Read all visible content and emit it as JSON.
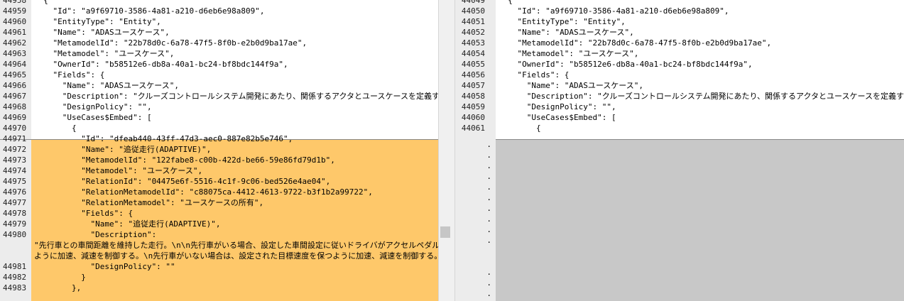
{
  "left": {
    "lines": [
      {
        "n": "44958",
        "t": "  {",
        "state": "same"
      },
      {
        "n": "44959",
        "t": "    \"Id\": \"a9f69710-3586-4a81-a210-d6eb6e98a809\",",
        "state": "same"
      },
      {
        "n": "44960",
        "t": "    \"EntityType\": \"Entity\",",
        "state": "same"
      },
      {
        "n": "44961",
        "t": "    \"Name\": \"ADASユースケース\",",
        "state": "same"
      },
      {
        "n": "44962",
        "t": "    \"MetamodelId\": \"22b78d0c-6a78-47f5-8f0b-e2b0d9ba17ae\",",
        "state": "same"
      },
      {
        "n": "44963",
        "t": "    \"Metamodel\": \"ユースケース\",",
        "state": "same"
      },
      {
        "n": "44964",
        "t": "    \"OwnerId\": \"b58512e6-db8a-40a1-bc24-bf8bdc144f9a\",",
        "state": "same"
      },
      {
        "n": "44965",
        "t": "    \"Fields\": {",
        "state": "same"
      },
      {
        "n": "44966",
        "t": "      \"Name\": \"ADASユースケース\",",
        "state": "same"
      },
      {
        "n": "44967",
        "t": "      \"Description\": \"クルーズコントロールシステム開発にあたり、関係するアクタとユースケースを定義する。\",",
        "state": "same"
      },
      {
        "n": "44968",
        "t": "      \"DesignPolicy\": \"\",",
        "state": "same"
      },
      {
        "n": "44969",
        "t": "      \"UseCases$Embed\": [",
        "state": "same"
      },
      {
        "n": "44970",
        "t": "        {",
        "state": "same"
      },
      {
        "n": "44971",
        "t": "          \"Id\": \"dfeab440-43ff-47d3-aec0-887e82b5e746\",",
        "state": "changed"
      },
      {
        "n": "44972",
        "t": "          \"Name\": \"追従走行(ADAPTIVE)\",",
        "state": "changed"
      },
      {
        "n": "44973",
        "t": "          \"MetamodelId\": \"122fabe8-c00b-422d-be66-59e86fd79d1b\",",
        "state": "changed"
      },
      {
        "n": "44974",
        "t": "          \"Metamodel\": \"ユースケース\",",
        "state": "changed"
      },
      {
        "n": "44975",
        "t": "          \"RelationId\": \"04475e6f-5516-4c1f-9c06-bed526e4ae04\",",
        "state": "changed"
      },
      {
        "n": "44976",
        "t": "          \"RelationMetamodelId\": \"c88075ca-4412-4613-9722-b3f1b2a99722\",",
        "state": "changed"
      },
      {
        "n": "44977",
        "t": "          \"RelationMetamodel\": \"ユースケースの所有\",",
        "state": "changed"
      },
      {
        "n": "44978",
        "t": "          \"Fields\": {",
        "state": "changed"
      },
      {
        "n": "44979",
        "t": "            \"Name\": \"追従走行(ADAPTIVE)\",",
        "state": "changed"
      },
      {
        "n": "44980",
        "t": "            \"Description\":",
        "state": "changed"
      },
      {
        "n": "",
        "t": "\"先行車との車間距離を維持した走行。\\n\\n先行車がいる場合、設定した車間設定に従いドライバがアクセルペダルを踏",
        "state": "wrap"
      },
      {
        "n": "",
        "t": "ように加速、減速を制御する。\\n先行車がいない場合は、設定された目標速度を保つように加速、減速を制御する。\",",
        "state": "wrap"
      },
      {
        "n": "44981",
        "t": "            \"DesignPolicy\": \"\"",
        "state": "changed"
      },
      {
        "n": "44982",
        "t": "          }",
        "state": "changed"
      },
      {
        "n": "44983",
        "t": "        },",
        "state": "changed"
      }
    ]
  },
  "right": {
    "lines": [
      {
        "n": "44049",
        "t": "  {"
      },
      {
        "n": "44050",
        "t": "    \"Id\": \"a9f69710-3586-4a81-a210-d6eb6e98a809\","
      },
      {
        "n": "44051",
        "t": "    \"EntityType\": \"Entity\","
      },
      {
        "n": "44052",
        "t": "    \"Name\": \"ADASユースケース\","
      },
      {
        "n": "44053",
        "t": "    \"MetamodelId\": \"22b78d0c-6a78-47f5-8f0b-e2b0d9ba17ae\","
      },
      {
        "n": "44054",
        "t": "    \"Metamodel\": \"ユースケース\","
      },
      {
        "n": "44055",
        "t": "    \"OwnerId\": \"b58512e6-db8a-40a1-bc24-bf8bdc144f9a\","
      },
      {
        "n": "44056",
        "t": "    \"Fields\": {"
      },
      {
        "n": "44057",
        "t": "      \"Name\": \"ADASユースケース\","
      },
      {
        "n": "44058",
        "t": "      \"Description\": \"クルーズコントロールシステム開発にあたり、関係するアクタとユースケースを定義する。\","
      },
      {
        "n": "44059",
        "t": "      \"DesignPolicy\": \"\","
      },
      {
        "n": "44060",
        "t": "      \"UseCases$Embed\": ["
      },
      {
        "n": "44061",
        "t": "        {"
      }
    ],
    "placeholder_dot": "."
  },
  "colors": {
    "changed": "#fec86a",
    "missing": "#c8c8c8",
    "gutter": "#ececec"
  }
}
